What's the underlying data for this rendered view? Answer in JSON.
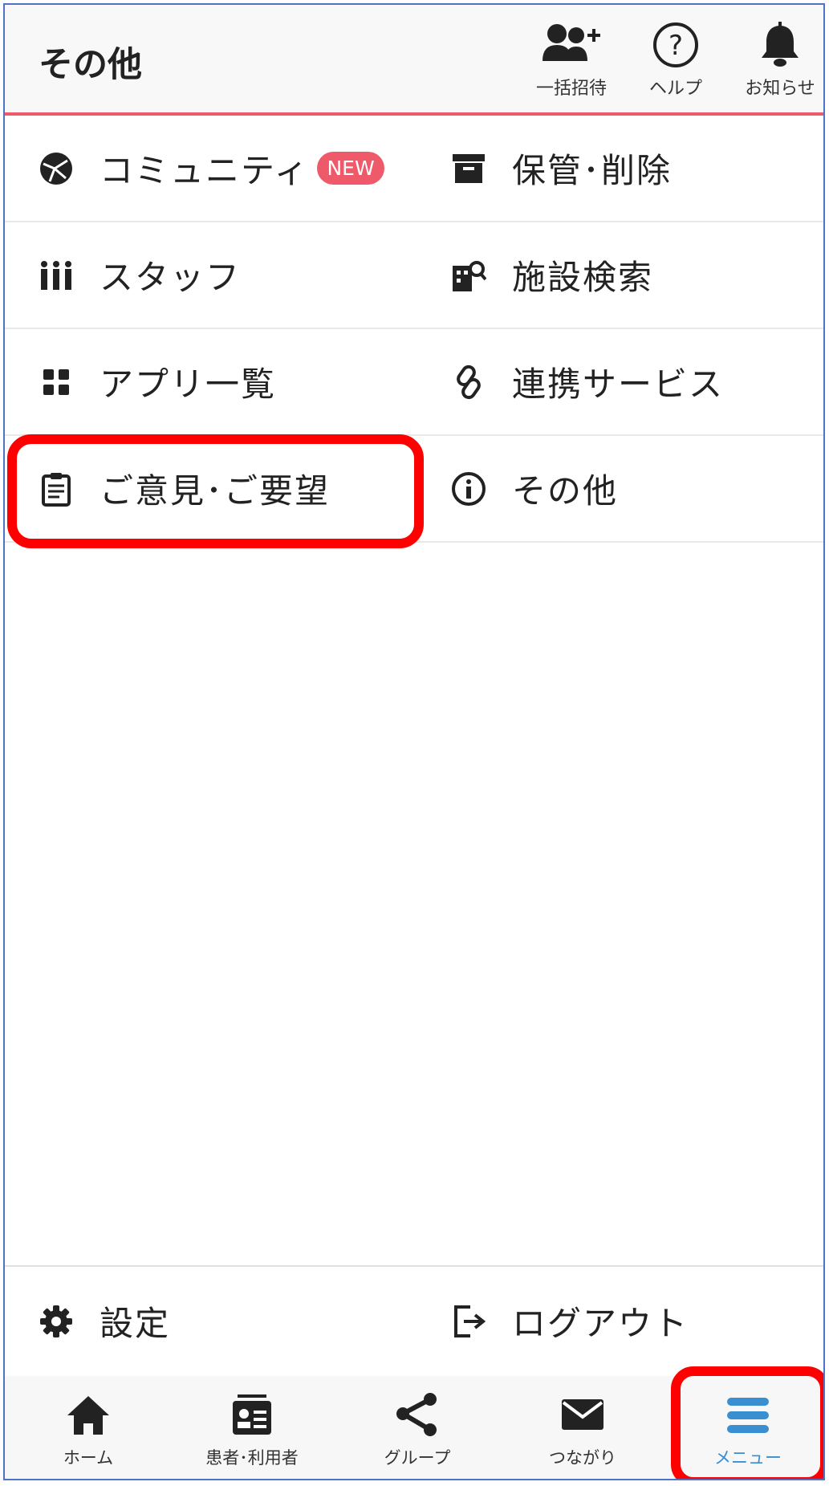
{
  "header": {
    "title": "その他",
    "buttons": [
      {
        "label": "一括招待",
        "icon": "users-plus-icon"
      },
      {
        "label": "ヘルプ",
        "icon": "help-circle-icon"
      },
      {
        "label": "お知らせ",
        "icon": "bell-icon"
      }
    ]
  },
  "menu": {
    "rows": [
      {
        "left": {
          "label": "コミュニティ",
          "icon": "globe-icon",
          "badge": "NEW"
        },
        "right": {
          "label": "保管･削除",
          "icon": "archive-icon"
        }
      },
      {
        "left": {
          "label": "スタッフ",
          "icon": "people-icon"
        },
        "right": {
          "label": "施設検索",
          "icon": "facility-search-icon"
        }
      },
      {
        "left": {
          "label": "アプリ一覧",
          "icon": "apps-grid-icon"
        },
        "right": {
          "label": "連携サービス",
          "icon": "link-icon"
        }
      },
      {
        "left": {
          "label": "ご意見･ご要望",
          "icon": "clipboard-icon"
        },
        "right": {
          "label": "その他",
          "icon": "info-icon"
        }
      }
    ]
  },
  "bottom_menu": {
    "settings": {
      "label": "設定",
      "icon": "gear-icon"
    },
    "logout": {
      "label": "ログアウト",
      "icon": "logout-icon"
    }
  },
  "nav": {
    "items": [
      {
        "label": "ホーム",
        "icon": "home-icon"
      },
      {
        "label": "患者･利用者",
        "icon": "id-card-icon"
      },
      {
        "label": "グループ",
        "icon": "share-nodes-icon"
      },
      {
        "label": "つながり",
        "icon": "envelope-icon"
      },
      {
        "label": "メニュー",
        "icon": "menu-icon",
        "active": true
      }
    ]
  },
  "colors": {
    "accent": "#ee5a6a",
    "active_nav": "#3a8fd0",
    "highlight": "#ff0000",
    "frame": "#4d72c8"
  }
}
